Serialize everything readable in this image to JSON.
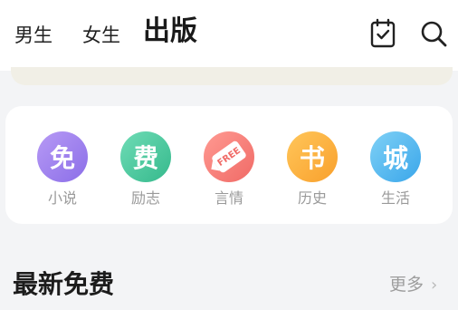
{
  "nav": {
    "tabs": [
      {
        "label": "男生"
      },
      {
        "label": "女生"
      },
      {
        "label": "出版"
      }
    ],
    "active_tab": "出版",
    "icons": [
      "calendar-check-icon",
      "search-icon"
    ]
  },
  "categories": [
    {
      "glyph": "免",
      "label": "小说",
      "color": "#8b6ee8"
    },
    {
      "glyph": "费",
      "label": "励志",
      "color": "#35b98c"
    },
    {
      "glyph": "FREE",
      "label": "言情",
      "color": "#f06a66"
    },
    {
      "glyph": "书",
      "label": "历史",
      "color": "#f9a02c"
    },
    {
      "glyph": "城",
      "label": "生活",
      "color": "#3aa6ea"
    }
  ],
  "section": {
    "title": "最新免费",
    "more_label": "更多",
    "more_icon": "chevron-right-icon"
  },
  "colors": {
    "accent_underline": "#f7c9b7",
    "background": "#f3f4f6"
  }
}
